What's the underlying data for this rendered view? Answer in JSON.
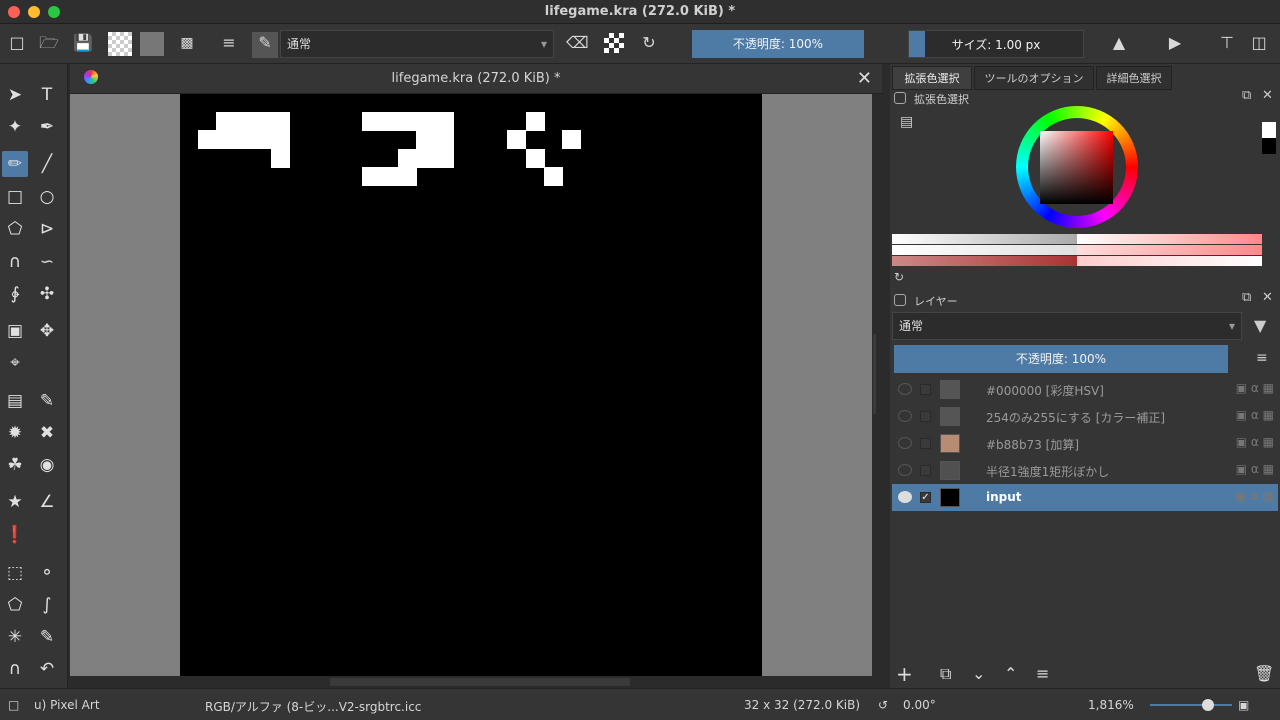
{
  "window": {
    "title": "lifegame.kra (272.0 KiB) *"
  },
  "toolbar": {
    "blend_mode": "通常",
    "opacity": "不透明度: 100%",
    "size": "サイズ: 1.00 px"
  },
  "document": {
    "tab_title": "lifegame.kra (272.0 KiB) *"
  },
  "dock": {
    "tabs": [
      "拡張色選択",
      "ツールのオプション",
      "詳細色選択"
    ],
    "color_panel_title": "拡張色選択",
    "layers_panel_title": "レイヤー",
    "layers_blend_mode": "通常",
    "layers_opacity": "不透明度: 100%",
    "layers": [
      {
        "name": "#000000 [彩度HSV]",
        "thumb_color": "#555555",
        "visible": false,
        "selected": false
      },
      {
        "name": "254のみ255にする [カラー補正]",
        "thumb_color": "#555555",
        "visible": false,
        "selected": false
      },
      {
        "name": "#b88b73 [加算]",
        "thumb_color": "#b88b73",
        "visible": false,
        "selected": false
      },
      {
        "name": "半径1強度1矩形ぼかし",
        "thumb_color": "#505050",
        "visible": false,
        "selected": false
      },
      {
        "name": "input",
        "thumb_color": "#000000",
        "visible": true,
        "selected": true
      }
    ]
  },
  "statusbar": {
    "brush_preset": "u) Pixel Art",
    "color_profile": "RGB/アルファ (8-ビッ...V2-srgbtrc.icc",
    "image_size": "32 x 32 (272.0 KiB)",
    "rotation": "0.00°",
    "zoom": "1,816%"
  },
  "colors": {
    "accent": "#4e7ba6",
    "canvas_bg": "#000000",
    "cell": "#ffffff"
  },
  "canvas_cells": [
    [
      1,
      2
    ],
    [
      2,
      1
    ],
    [
      2,
      2
    ],
    [
      3,
      1
    ],
    [
      3,
      2
    ],
    [
      4,
      1
    ],
    [
      4,
      2
    ],
    [
      5,
      1
    ],
    [
      5,
      2
    ],
    [
      5,
      3
    ],
    [
      10,
      1
    ],
    [
      11,
      1
    ],
    [
      12,
      1
    ],
    [
      13,
      1
    ],
    [
      14,
      1
    ],
    [
      13,
      2
    ],
    [
      14,
      2
    ],
    [
      12,
      3
    ],
    [
      12,
      4
    ],
    [
      13,
      3
    ],
    [
      14,
      3
    ],
    [
      10,
      4
    ],
    [
      11,
      4
    ],
    [
      18,
      2
    ],
    [
      19,
      3
    ],
    [
      20,
      4
    ],
    [
      19,
      1
    ],
    [
      21,
      2
    ]
  ]
}
